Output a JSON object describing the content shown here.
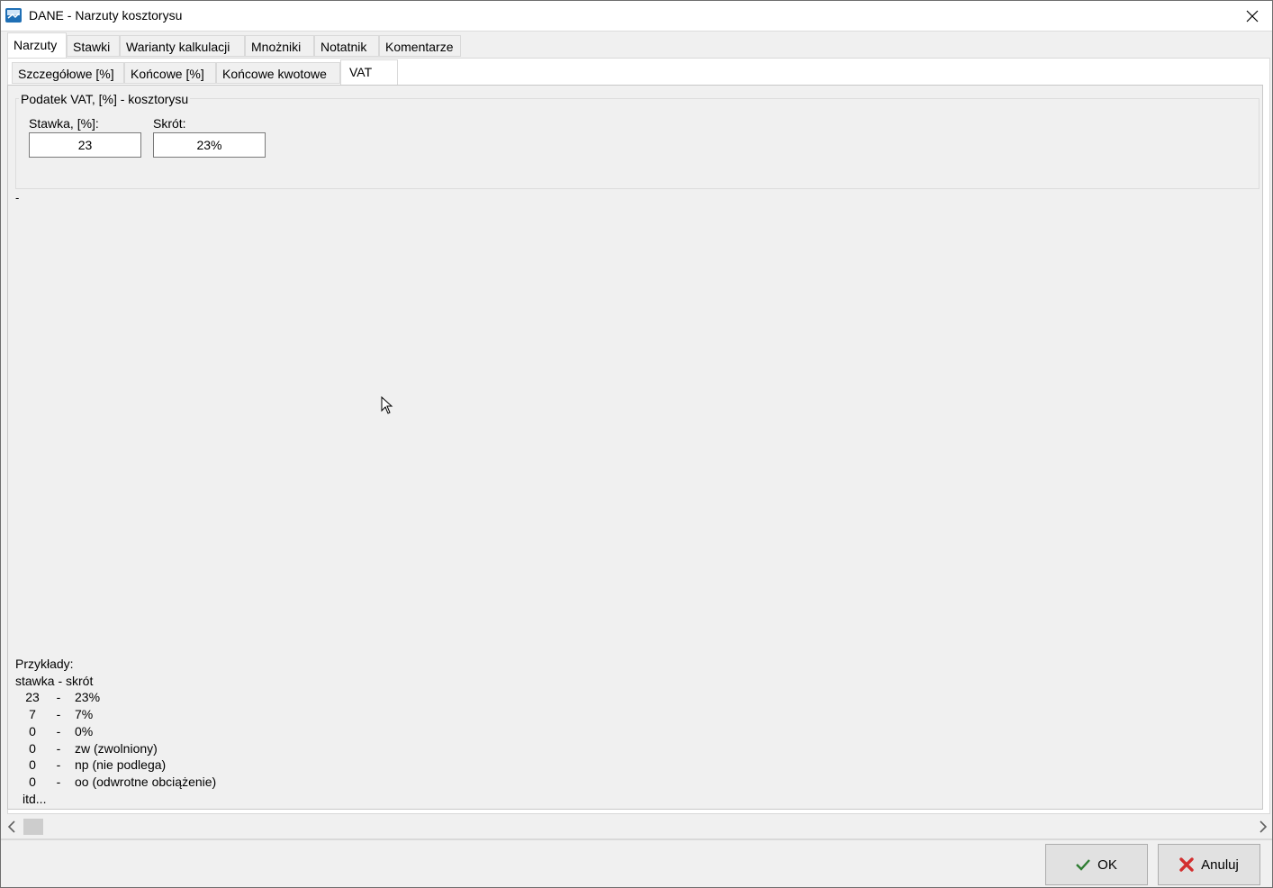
{
  "window": {
    "title": "DANE - Narzuty kosztorysu"
  },
  "main_tabs": [
    "Narzuty",
    "Stawki",
    "Warianty kalkulacji",
    "Mnożniki",
    "Notatnik",
    "Komentarze"
  ],
  "sub_tabs": [
    "Szczegółowe [%]",
    "Końcowe [%]",
    "Końcowe kwotowe",
    "VAT"
  ],
  "vat_group": {
    "legend": "Podatek VAT, [%] - kosztorysu",
    "rate_label": "Stawka, [%]:",
    "rate_value": "23",
    "short_label": "Skrót:",
    "short_value": "23%"
  },
  "dash_text": "-",
  "examples": {
    "heading": "Przykłady:",
    "subheading": "stawka - skrót",
    "rows": [
      [
        "23",
        "-",
        "23%"
      ],
      [
        "7",
        "-",
        "7%"
      ],
      [
        "0",
        "-",
        "0%"
      ],
      [
        "0",
        "-",
        "zw (zwolniony)"
      ],
      [
        "0",
        "-",
        "np (nie podlega)"
      ],
      [
        "0",
        "-",
        "oo (odwrotne obciążenie)"
      ]
    ],
    "footer": "itd..."
  },
  "buttons": {
    "ok": "OK",
    "cancel": "Anuluj"
  },
  "colors": {
    "ok_check": "#2e7d32",
    "cancel_x": "#d32f2f"
  }
}
